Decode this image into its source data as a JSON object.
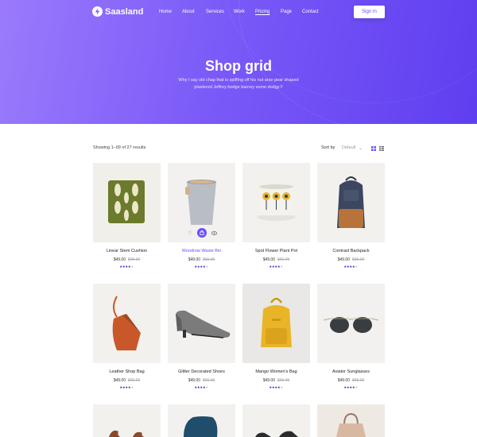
{
  "brand": {
    "name": "Saasland"
  },
  "nav": {
    "items": [
      {
        "label": "Home"
      },
      {
        "label": "About"
      },
      {
        "label": "Services"
      },
      {
        "label": "Work"
      },
      {
        "label": "Pricing",
        "active": true
      },
      {
        "label": "Page"
      },
      {
        "label": "Contact"
      }
    ],
    "signin_label": "Sign In"
  },
  "hero": {
    "title": "Shop grid",
    "subtitle": "Why I say old chap that is spiffing off his nut arse pear shaped plastered Jeffrey bodge barney some dodgy.!!"
  },
  "toolbar": {
    "results_text": "Showing 1–09 of 27 results",
    "sort_label": "Sort by",
    "sort_value": "Default"
  },
  "products": [
    {
      "name": "Linear Stem Cushion",
      "price": "$49.00",
      "old_price": "$65.00",
      "rating": 4
    },
    {
      "name": "Woodrow Waste Bin",
      "price": "$49.00",
      "old_price": "$65.00",
      "rating": 4,
      "hovered": true
    },
    {
      "name": "Spot Flower Plant Pot",
      "price": "$49.00",
      "old_price": "$65.00",
      "rating": 4
    },
    {
      "name": "Contrast Backpack",
      "price": "$49.00",
      "old_price": "$65.00",
      "rating": 4
    },
    {
      "name": "Leather Shop Bag",
      "price": "$49.00",
      "old_price": "$65.00",
      "rating": 4
    },
    {
      "name": "Glitter Decorated Shoes",
      "price": "$49.00",
      "old_price": "$65.00",
      "rating": 4
    },
    {
      "name": "Mango Women's Bag",
      "price": "$49.00",
      "old_price": "$65.00",
      "rating": 4
    },
    {
      "name": "Aviator Sunglasses",
      "price": "$49.00",
      "old_price": "$65.00",
      "rating": 4
    }
  ],
  "colors": {
    "accent": "#6b4cf6",
    "hero_start": "#9a7bfb",
    "hero_end": "#5f3ef0"
  }
}
